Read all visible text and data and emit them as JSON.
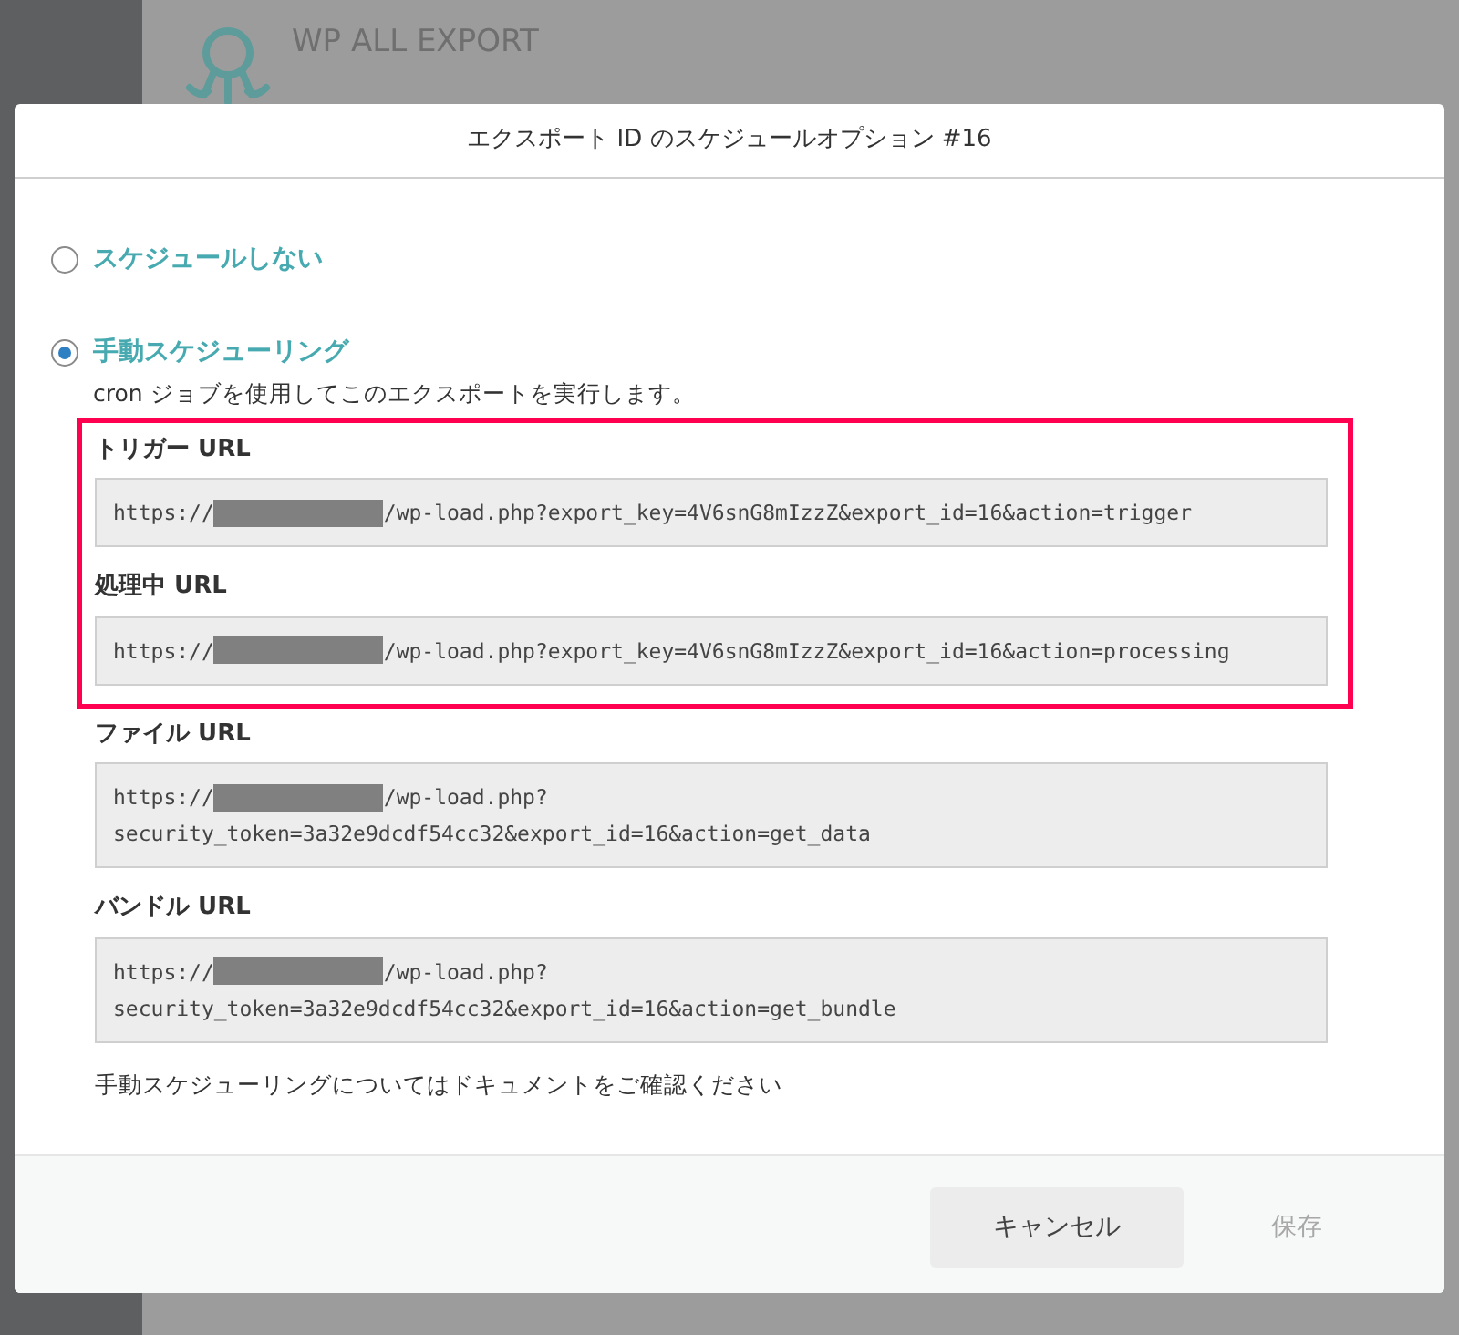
{
  "background": {
    "brand": "WP ALL EXPORT"
  },
  "dialog": {
    "title": "エクスポート ID のスケジュールオプション #16",
    "options": [
      {
        "label": "スケジュールしない",
        "selected": false
      },
      {
        "label": "手動スケジューリング",
        "selected": true,
        "description": "cron ジョブを使用してこのエクスポートを実行します。"
      }
    ],
    "highlighted_urls": [
      {
        "label": "トリガー URL",
        "prefix": "https://",
        "rest": "/wp-load.php?export_key=4V6snG8mIzzZ&export_id=16&action=trigger"
      },
      {
        "label": "処理中 URL",
        "prefix": "https://",
        "rest": "/wp-load.php?export_key=4V6snG8mIzzZ&export_id=16&action=processing"
      }
    ],
    "other_urls": [
      {
        "label": "ファイル URL",
        "prefix": "https://",
        "rest": "/wp-load.php?",
        "continuation": "security_token=3a32e9dcdf54cc32&export_id=16&action=get_data"
      },
      {
        "label": "バンドル URL",
        "prefix": "https://",
        "rest": "/wp-load.php?",
        "continuation": "security_token=3a32e9dcdf54cc32&export_id=16&action=get_bundle"
      }
    ],
    "note": "手動スケジューリングについてはドキュメントをご確認ください",
    "buttons": [
      {
        "label": "キャンセル",
        "disabled": false
      },
      {
        "label": "保存",
        "disabled": true
      }
    ]
  }
}
